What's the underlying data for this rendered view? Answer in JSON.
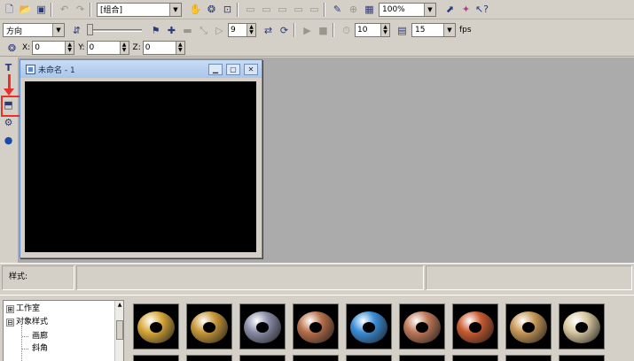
{
  "toolbar1": {
    "group_combo": "[组合]",
    "zoom_combo": "100%"
  },
  "toolbar2": {
    "direction_combo": "方向",
    "frame_spin": "9",
    "speed_spin": "10",
    "fps_spin": "15",
    "fps_label": "fps"
  },
  "toolbar3": {
    "x_label": "X:",
    "x_value": "0",
    "y_label": "Y:",
    "y_value": "0",
    "z_label": "Z:",
    "z_value": "0"
  },
  "document": {
    "title": "未命名 - 1"
  },
  "status": {
    "style_label": "样式:"
  },
  "tree": {
    "items": [
      {
        "label": "工作室",
        "expander": "⊞"
      },
      {
        "label": "对象样式",
        "expander": "⊟"
      },
      {
        "label": "画廊"
      },
      {
        "label": "斜角"
      }
    ]
  },
  "gallery": {
    "styles": [
      {
        "name": "gold-torus",
        "color": "#d8a838"
      },
      {
        "name": "brass-torus",
        "color": "#c89838"
      },
      {
        "name": "chrome-torus",
        "color": "#8a8ea8"
      },
      {
        "name": "copper-torus",
        "color": "#b8704a"
      },
      {
        "name": "blue-marble-torus",
        "color": "#3a8ed8"
      },
      {
        "name": "pink-stone-torus",
        "color": "#c07858"
      },
      {
        "name": "terracotta-torus",
        "color": "#c85a30"
      },
      {
        "name": "leopard-torus",
        "color": "#c89858"
      },
      {
        "name": "beige-pattern-torus",
        "color": "#d8c8a0"
      }
    ]
  },
  "colors": {
    "highlight": "#e8302c",
    "workspace": "#ababab",
    "canvas": "#000000"
  }
}
